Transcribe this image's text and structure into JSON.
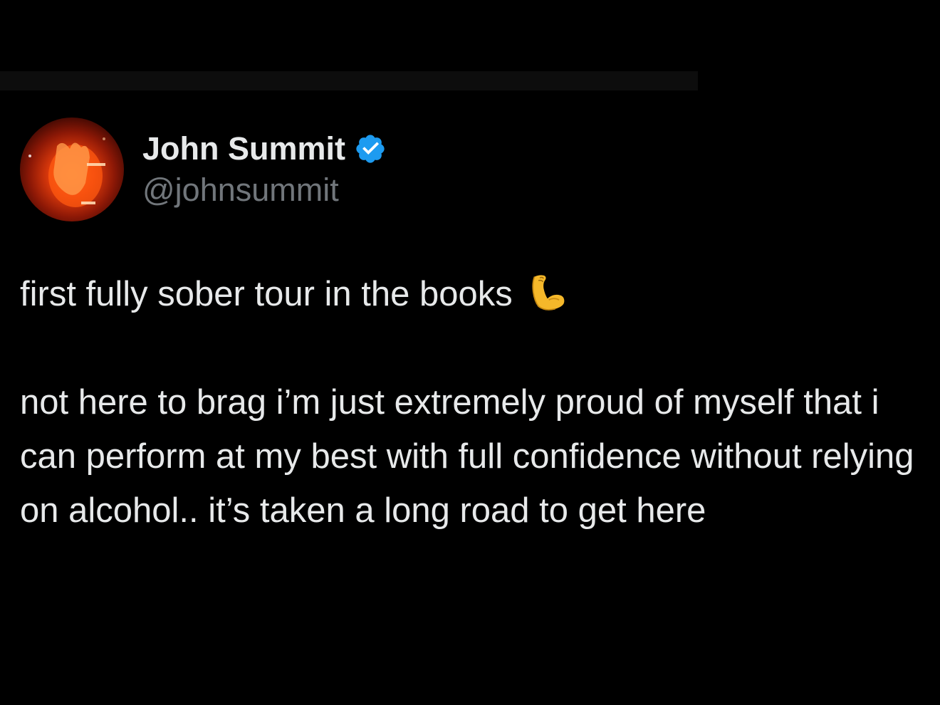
{
  "tweet": {
    "display_name": "John Summit",
    "handle": "@johnsummit",
    "verified": true,
    "paragraphs": [
      "first fully sober tour in the books",
      "not here to brag i’m just extremely proud of myself that i can perform at my best with full confidence without relying on alcohol.. it’s taken a long road to get here"
    ],
    "emoji": "flexed-biceps",
    "emoji_char": "💪"
  },
  "colors": {
    "background": "#000000",
    "text_primary": "#e7e9ea",
    "text_secondary": "#71767b",
    "verified_badge": "#1d9bf0"
  }
}
